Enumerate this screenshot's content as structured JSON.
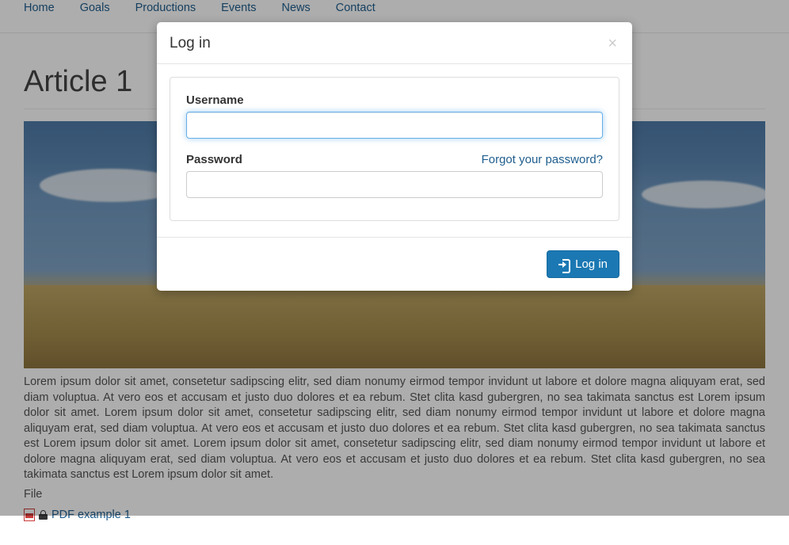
{
  "nav": {
    "items": [
      {
        "label": "Home"
      },
      {
        "label": "Goals"
      },
      {
        "label": "Productions"
      },
      {
        "label": "Events"
      },
      {
        "label": "News"
      },
      {
        "label": "Contact"
      }
    ]
  },
  "article": {
    "title": "Article 1",
    "body": "Lorem ipsum dolor sit amet, consetetur sadipscing elitr, sed diam nonumy eirmod tempor invidunt ut labore et dolore magna aliquyam erat, sed diam voluptua. At vero eos et accusam et justo duo dolores et ea rebum. Stet clita kasd gubergren, no sea takimata sanctus est Lorem ipsum dolor sit amet. Lorem ipsum dolor sit amet, consetetur sadipscing elitr, sed diam nonumy eirmod tempor invidunt ut labore et dolore magna aliquyam erat, sed diam voluptua. At vero eos et accusam et justo duo dolores et ea rebum. Stet clita kasd gubergren, no sea takimata sanctus est Lorem ipsum dolor sit amet. Lorem ipsum dolor sit amet, consetetur sadipscing elitr, sed diam nonumy eirmod tempor invidunt ut labore et dolore magna aliquyam erat, sed diam voluptua. At vero eos et accusam et justo duo dolores et ea rebum. Stet clita kasd gubergren, no sea takimata sanctus est Lorem ipsum dolor sit amet.",
    "file_section_label": "File",
    "attachment": {
      "label": "PDF example 1"
    }
  },
  "login_modal": {
    "title": "Log in",
    "username_label": "Username",
    "username_value": "",
    "password_label": "Password",
    "password_value": "",
    "forgot_link": "Forgot your password?",
    "submit_label": "Log in"
  }
}
